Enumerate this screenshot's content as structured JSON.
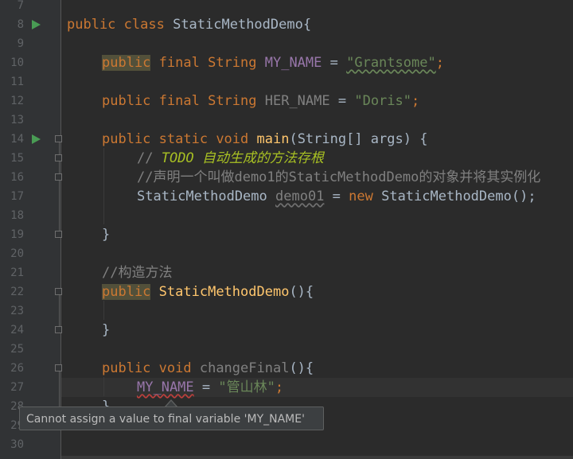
{
  "editor": {
    "line_numbers": [
      "7",
      "8",
      "9",
      "10",
      "11",
      "12",
      "13",
      "14",
      "15",
      "16",
      "17",
      "18",
      "19",
      "20",
      "21",
      "22",
      "23",
      "24",
      "25",
      "26",
      "27",
      "28",
      "29",
      "30"
    ],
    "lines": {
      "l8": [
        "public",
        " class ",
        "StaticMethodDemo{"
      ],
      "l10": [
        "public",
        " final ",
        "String ",
        "MY_NAME",
        " = ",
        "\"Grantsome\"",
        ";"
      ],
      "l12": [
        "public",
        " final ",
        "String ",
        "HER_NAME",
        " = ",
        "\"Doris\"",
        ";"
      ],
      "l14": [
        "public",
        " static ",
        "void ",
        "main",
        "(String[] args) {"
      ],
      "l15": [
        "// ",
        "TODO 自动生成的方法存根"
      ],
      "l16": "//声明一个叫做demo1的StaticMethodDemo的对象并将其实例化",
      "l17": [
        "StaticMethodDemo ",
        "demo01",
        " = ",
        "new ",
        "StaticMethodDemo();"
      ],
      "l19": "}",
      "l21": "//构造方法",
      "l22": [
        "public",
        " ",
        "StaticMethodDemo",
        "(){"
      ],
      "l24": "}",
      "l26": [
        "public",
        " void ",
        "changeFinal",
        "(){"
      ],
      "l27": [
        "MY_NAME",
        " = ",
        "\"管山林\"",
        ";"
      ],
      "l28": "}"
    }
  },
  "tooltip": {
    "text": "Cannot assign a value to final variable 'MY_NAME'"
  },
  "colors": {
    "background": "#2b2b2b",
    "gutter": "#313335",
    "keyword": "#cc7832",
    "field": "#9876aa",
    "string": "#6a8759",
    "method": "#ffc66d",
    "comment": "#808080",
    "todo": "#a8c023",
    "run_icon": "#499c54"
  },
  "icons": [
    "run-gutter-icon",
    "fold-marker-icon"
  ]
}
